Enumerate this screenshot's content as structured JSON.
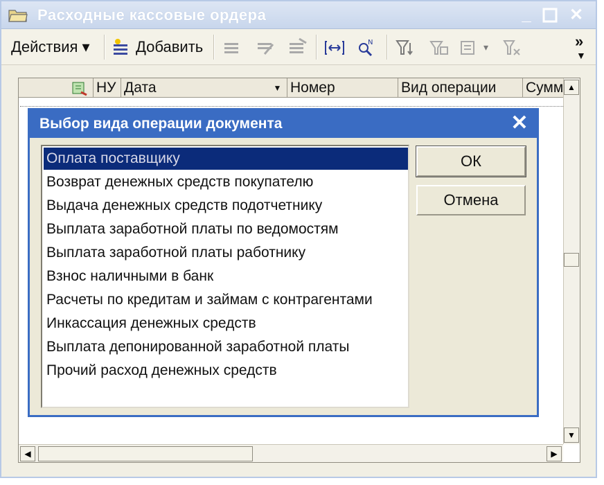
{
  "window": {
    "title": "Расходные кассовые ордера",
    "minimize": "_",
    "close": "✕"
  },
  "toolbar": {
    "actions_label": "Действия ▾",
    "add_label": "Добавить",
    "overflow_label": "»"
  },
  "grid": {
    "columns": [
      "НУ",
      "Дата",
      "Номер",
      "Вид операции",
      "Сумм"
    ],
    "scroll_up": "▲",
    "scroll_down": "▼",
    "scroll_left": "◀",
    "scroll_right": "▶"
  },
  "dialog": {
    "title": "Выбор вида операции документа",
    "close": "✕",
    "ok_label": "ОК",
    "cancel_label": "Отмена",
    "items": [
      "Оплата поставщику",
      "Возврат денежных средств покупателю",
      "Выдача денежных средств подотчетнику",
      "Выплата заработной платы по ведомостям",
      "Выплата заработной платы работнику",
      "Взнос наличными в банк",
      "Расчеты по кредитам и займам с контрагентами",
      "Инкассация денежных средств",
      "Выплата депонированной заработной платы",
      "Прочий расход денежных средств"
    ],
    "selected_index": 0
  },
  "colors": {
    "dialog_title_bg": "#3a6cc3",
    "selection_bg": "#0b2b7a",
    "window_bg": "#f1efe4"
  }
}
